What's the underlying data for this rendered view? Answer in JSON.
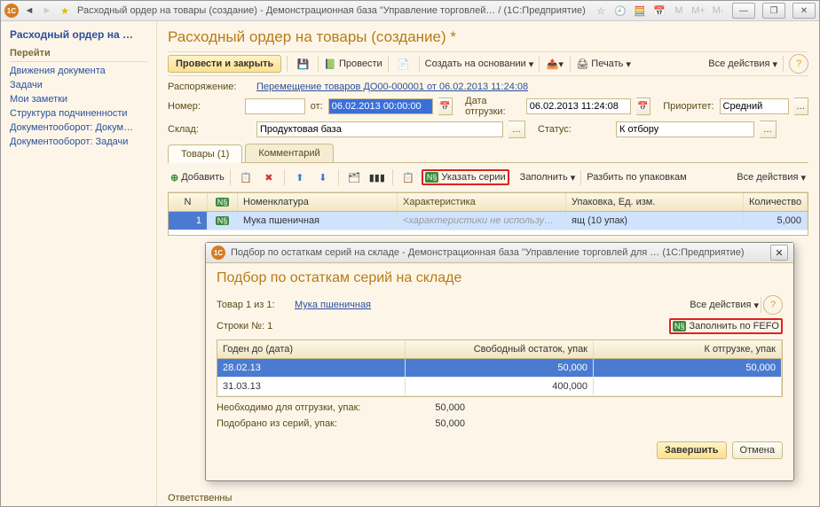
{
  "window": {
    "title": "Расходный ордер на товары (создание) - Демонстрационная база \"Управление торговлей… / (1С:Предприятие)"
  },
  "sidebar": {
    "title": "Расходный ордер на …",
    "nav_label": "Перейти",
    "links": {
      "l1": "Движения документа",
      "l2": "Задачи",
      "l3": "Мои заметки",
      "l4": "Структура подчиненности",
      "l5": "Документооборот: Докум…",
      "l6": "Документооборот: Задачи"
    }
  },
  "page": {
    "title": "Расходный ордер на товары (создание) *",
    "toolbar": {
      "post_close": "Провести и закрыть",
      "post": "Провести",
      "create_based": "Создать на основании",
      "print": "Печать",
      "all_actions": "Все действия"
    },
    "form": {
      "order_label": "Распоряжение:",
      "order_link": "Перемещение товаров ДО00-000001 от 06.02.2013 11:24:08",
      "number_label": "Номер:",
      "number_value": "",
      "from_label": "от:",
      "date_value": "06.02.2013 00:00:00",
      "ship_date_label": "Дата отгрузки:",
      "ship_date_value": "06.02.2013 11:24:08",
      "priority_label": "Приоритет:",
      "priority_value": "Средний",
      "warehouse_label": "Склад:",
      "warehouse_value": "Продуктовая база",
      "status_label": "Статус:",
      "status_value": "К отбору"
    },
    "tabs": {
      "goods": "Товары (1)",
      "comment": "Комментарий"
    },
    "subtb": {
      "add": "Добавить",
      "series": "Указать серии",
      "fill": "Заполнить",
      "split": "Разбить по упаковкам",
      "all_actions": "Все действия"
    },
    "grid": {
      "h_n": "N",
      "h_nom": "Номенклатура",
      "h_char": "Характеристика",
      "h_pack": "Упаковка, Ед. изм.",
      "h_qty": "Количество",
      "r1_n": "1",
      "r1_nom": "Мука пшеничная",
      "r1_char": "<характеристики не использу…",
      "r1_pack": "ящ (10 упак)",
      "r1_qty": "5,000"
    },
    "resp_label": "Ответственны"
  },
  "modal": {
    "title": "Подбор по остаткам серий на складе - Демонстрационная база \"Управление торговлей для …    (1С:Предприятие)",
    "heading": "Подбор по остаткам серий на складе",
    "product_label": "Товар 1 из 1:",
    "product_link": "Мука пшеничная",
    "all_actions": "Все действия",
    "rows_label": "Строки №: 1",
    "fill_fefo": "Заполнить по FEFO",
    "grid": {
      "h_date": "Годен до (дата)",
      "h_free": "Свободный остаток, упак",
      "h_ship": "К отгрузке, упак",
      "r1_date": "28.02.13",
      "r1_free": "50,000",
      "r1_ship": "50,000",
      "r2_date": "31.03.13",
      "r2_free": "400,000",
      "r2_ship": ""
    },
    "sum1_label": "Необходимо для отгрузки, упак:",
    "sum1_val": "50,000",
    "sum2_label": "Подобрано из серий, упак:",
    "sum2_val": "50,000",
    "btn_finish": "Завершить",
    "btn_cancel": "Отмена"
  },
  "chart_data": {
    "type": "table",
    "title": "Товары",
    "columns": [
      "N",
      "Номенклатура",
      "Характеристика",
      "Упаковка, Ед. изм.",
      "Количество"
    ],
    "rows": [
      [
        "1",
        "Мука пшеничная",
        "<характеристики не использу…",
        "ящ (10 упак)",
        "5,000"
      ]
    ],
    "modal_table": {
      "title": "Подбор по остаткам серий на складе",
      "columns": [
        "Годен до (дата)",
        "Свободный остаток, упак",
        "К отгрузке, упак"
      ],
      "rows": [
        [
          "28.02.13",
          50000,
          50000
        ],
        [
          "31.03.13",
          400000,
          null
        ]
      ],
      "totals": {
        "Необходимо для отгрузки, упак": 50000,
        "Подобрано из серий, упак": 50000
      }
    }
  }
}
